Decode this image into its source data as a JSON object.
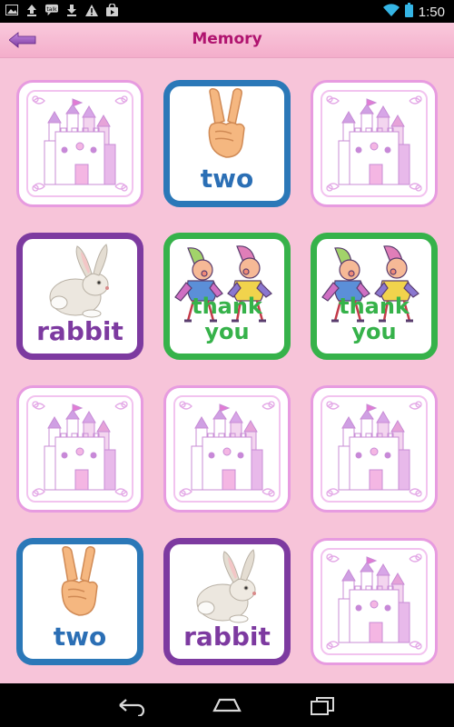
{
  "status": {
    "time": "1:50",
    "icons": [
      "image-notification-icon",
      "upload-icon",
      "talk-icon",
      "download-icon",
      "warning-icon",
      "shopping-bag-icon",
      "wifi-icon",
      "battery-icon"
    ]
  },
  "app": {
    "title": "Memory",
    "back_icon": "back-arrow-icon"
  },
  "cards": [
    {
      "state": "back",
      "image": "castle"
    },
    {
      "state": "face",
      "image": "two-fingers",
      "word": "two",
      "color": "blue"
    },
    {
      "state": "back",
      "image": "castle"
    },
    {
      "state": "face",
      "image": "rabbit",
      "word": "rabbit",
      "color": "purple"
    },
    {
      "state": "face",
      "image": "elves",
      "word": "thank you",
      "color": "green"
    },
    {
      "state": "face",
      "image": "elves",
      "word": "thank you",
      "color": "green"
    },
    {
      "state": "back",
      "image": "castle"
    },
    {
      "state": "back",
      "image": "castle"
    },
    {
      "state": "back",
      "image": "castle"
    },
    {
      "state": "face",
      "image": "two-fingers",
      "word": "two",
      "color": "blue"
    },
    {
      "state": "face",
      "image": "rabbit",
      "word": "rabbit",
      "color": "purple"
    },
    {
      "state": "back",
      "image": "castle"
    }
  ],
  "colors": {
    "background": "#f7c4d9",
    "title": "#b0136f",
    "blue": "#2b78b8",
    "purple": "#7d3aa0",
    "green": "#36b24a"
  },
  "navbar": {
    "icons": [
      "back-icon",
      "home-icon",
      "recent-apps-icon"
    ]
  }
}
